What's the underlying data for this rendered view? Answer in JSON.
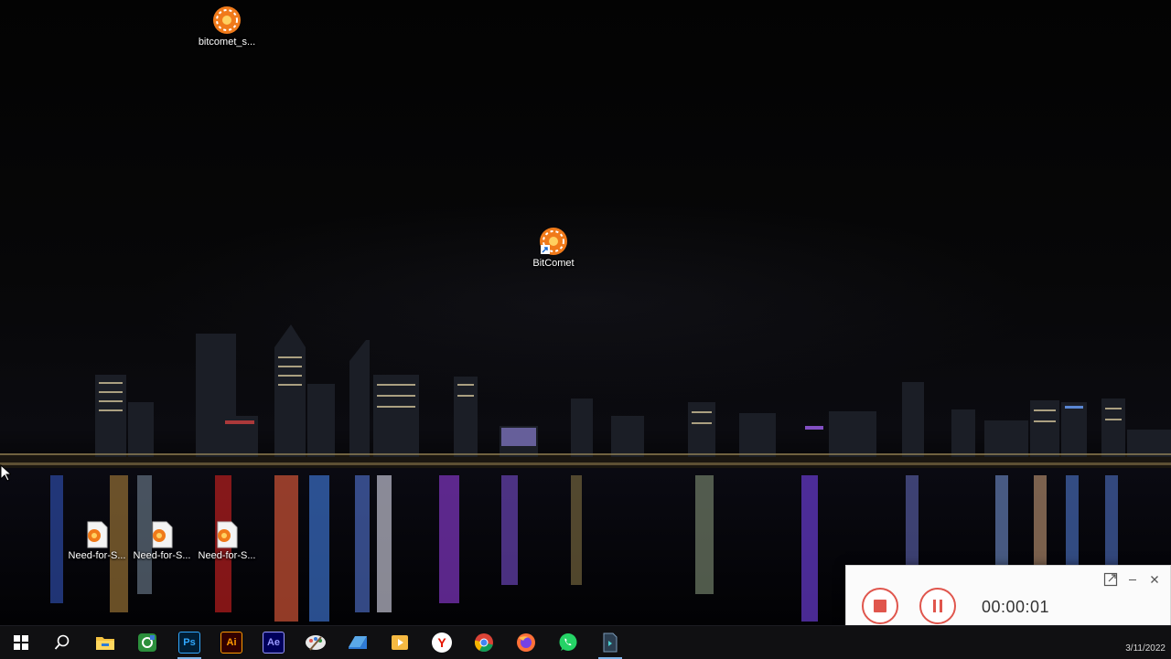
{
  "desktop": {
    "icons": [
      {
        "label": "bitcomet_s...",
        "icon": "bitcomet-icon"
      },
      {
        "label": "BitComet",
        "icon": "bitcomet-shortcut-icon"
      },
      {
        "label": "Need-for-S...",
        "icon": "torrent-file-icon"
      },
      {
        "label": "Need-for-S...",
        "icon": "torrent-file-icon"
      },
      {
        "label": "Need-for-S...",
        "icon": "torrent-file-icon"
      }
    ],
    "wallpaper": "night-city-skyline-over-water"
  },
  "taskbar": {
    "items": [
      {
        "name": "start-icon"
      },
      {
        "name": "search-icon"
      },
      {
        "name": "file-explorer-icon"
      },
      {
        "name": "camtasia-icon"
      },
      {
        "name": "photoshop-icon",
        "text": "Ps"
      },
      {
        "name": "illustrator-icon",
        "text": "Ai"
      },
      {
        "name": "after-effects-icon",
        "text": "Ae"
      },
      {
        "name": "paint-icon"
      },
      {
        "name": "folder-app-icon"
      },
      {
        "name": "media-icon"
      },
      {
        "name": "yandex-browser-icon",
        "text": "Y"
      },
      {
        "name": "chrome-icon"
      },
      {
        "name": "firefox-icon"
      },
      {
        "name": "whatsapp-icon"
      },
      {
        "name": "bitcomet-installer-icon"
      }
    ],
    "date": "3/11/2022"
  },
  "recorder": {
    "time": "00:00:01",
    "accent": "#e0564d"
  }
}
